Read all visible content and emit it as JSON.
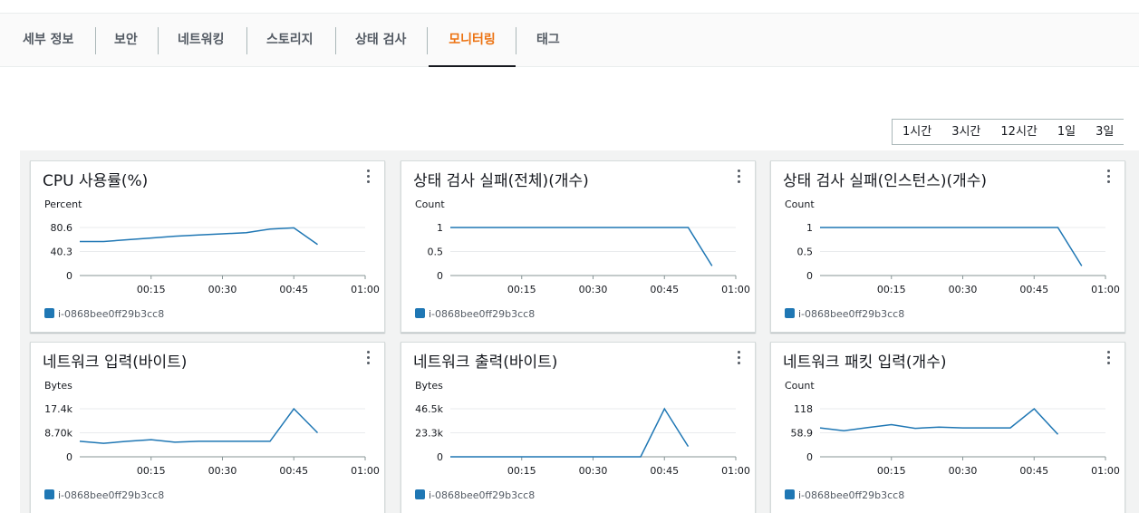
{
  "tabs": [
    {
      "label": "세부 정보",
      "active": false
    },
    {
      "label": "보안",
      "active": false
    },
    {
      "label": "네트워킹",
      "active": false
    },
    {
      "label": "스토리지",
      "active": false
    },
    {
      "label": "상태 검사",
      "active": false
    },
    {
      "label": "모니터링",
      "active": true
    },
    {
      "label": "태그",
      "active": false
    }
  ],
  "time_ranges": [
    "1시간",
    "3시간",
    "12시간",
    "1일",
    "3일"
  ],
  "legend_color": "#1f77b4",
  "accent_color": "#ec7211",
  "widgets": [
    {
      "title": "CPU 사용률(%)",
      "unit": "Percent",
      "legend": "i-0868bee0ff29b3cc8",
      "menu_icon": "kebab-vertical-icon",
      "chart_data": {
        "type": "line",
        "y_ticks": [
          "80.6",
          "40.3",
          "0"
        ],
        "ylim": [
          0,
          80.6
        ],
        "x_ticks": [
          "00:15",
          "00:30",
          "00:45",
          "01:00"
        ],
        "xlim": [
          0,
          60
        ],
        "series": [
          {
            "name": "i-0868bee0ff29b3cc8",
            "x": [
              0,
              5,
              10,
              15,
              20,
              25,
              30,
              35,
              40,
              45,
              50,
              55
            ],
            "values": [
              57,
              57,
              60,
              63,
              66,
              68,
              70,
              72,
              78,
              80,
              52
            ]
          }
        ]
      }
    },
    {
      "title": "상태 검사 실패(전체)(개수)",
      "unit": "Count",
      "legend": "i-0868bee0ff29b3cc8",
      "menu_icon": "kebab-vertical-icon",
      "chart_data": {
        "type": "line",
        "y_ticks": [
          "1",
          "0.5",
          "0"
        ],
        "ylim": [
          0,
          1
        ],
        "x_ticks": [
          "00:15",
          "00:30",
          "00:45",
          "01:00"
        ],
        "xlim": [
          0,
          60
        ],
        "series": [
          {
            "name": "i-0868bee0ff29b3cc8",
            "x": [
              0,
              50,
              55
            ],
            "values": [
              1,
              1,
              0.2
            ]
          }
        ]
      }
    },
    {
      "title": "상태 검사 실패(인스턴스)(개수)",
      "unit": "Count",
      "legend": "i-0868bee0ff29b3cc8",
      "menu_icon": "kebab-vertical-icon",
      "chart_data": {
        "type": "line",
        "y_ticks": [
          "1",
          "0.5",
          "0"
        ],
        "ylim": [
          0,
          1
        ],
        "x_ticks": [
          "00:15",
          "00:30",
          "00:45",
          "01:00"
        ],
        "xlim": [
          0,
          60
        ],
        "series": [
          {
            "name": "i-0868bee0ff29b3cc8",
            "x": [
              0,
              50,
              55
            ],
            "values": [
              1,
              1,
              0.2
            ]
          }
        ]
      }
    },
    {
      "title": "네트워크 입력(바이트)",
      "unit": "Bytes",
      "legend": "i-0868bee0ff29b3cc8",
      "menu_icon": "kebab-vertical-icon",
      "chart_data": {
        "type": "line",
        "y_ticks": [
          "17.4k",
          "8.70k",
          "0"
        ],
        "ylim": [
          0,
          17400
        ],
        "x_ticks": [
          "00:15",
          "00:30",
          "00:45",
          "01:00"
        ],
        "xlim": [
          0,
          60
        ],
        "series": [
          {
            "name": "i-0868bee0ff29b3cc8",
            "x": [
              0,
              5,
              10,
              15,
              20,
              25,
              30,
              35,
              40,
              45,
              50,
              55
            ],
            "values": [
              5600,
              4900,
              5600,
              6200,
              5300,
              5600,
              5600,
              5600,
              5600,
              17400,
              8700
            ]
          }
        ]
      }
    },
    {
      "title": "네트워크 출력(바이트)",
      "unit": "Bytes",
      "legend": "i-0868bee0ff29b3cc8",
      "menu_icon": "kebab-vertical-icon",
      "chart_data": {
        "type": "line",
        "y_ticks": [
          "46.5k",
          "23.3k",
          "0"
        ],
        "ylim": [
          0,
          46500
        ],
        "x_ticks": [
          "00:15",
          "00:30",
          "00:45",
          "01:00"
        ],
        "xlim": [
          0,
          60
        ],
        "series": [
          {
            "name": "i-0868bee0ff29b3cc8",
            "x": [
              0,
              5,
              10,
              15,
              20,
              25,
              30,
              35,
              40,
              45,
              50,
              55
            ],
            "values": [
              0,
              0,
              0,
              0,
              0,
              0,
              0,
              0,
              0,
              46500,
              10000
            ]
          }
        ]
      }
    },
    {
      "title": "네트워크 패킷 입력(개수)",
      "unit": "Count",
      "legend": "i-0868bee0ff29b3cc8",
      "menu_icon": "kebab-vertical-icon",
      "chart_data": {
        "type": "line",
        "y_ticks": [
          "118",
          "58.9",
          "0"
        ],
        "ylim": [
          0,
          118
        ],
        "x_ticks": [
          "00:15",
          "00:30",
          "00:45",
          "01:00"
        ],
        "xlim": [
          0,
          60
        ],
        "series": [
          {
            "name": "i-0868bee0ff29b3cc8",
            "x": [
              0,
              5,
              10,
              15,
              20,
              25,
              30,
              35,
              40,
              45,
              50,
              55
            ],
            "values": [
              71,
              64,
              72,
              79,
              70,
              73,
              71,
              71,
              71,
              118,
              55
            ]
          }
        ]
      }
    }
  ]
}
